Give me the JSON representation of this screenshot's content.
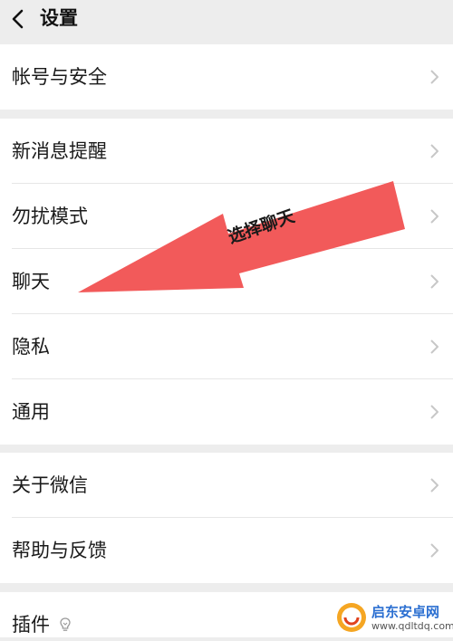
{
  "header": {
    "title": "设置"
  },
  "groups": [
    {
      "items": [
        {
          "label": "帐号与安全"
        }
      ]
    },
    {
      "items": [
        {
          "label": "新消息提醒"
        },
        {
          "label": "勿扰模式"
        },
        {
          "label": "聊天"
        },
        {
          "label": "隐私"
        },
        {
          "label": "通用"
        }
      ]
    },
    {
      "items": [
        {
          "label": "关于微信"
        },
        {
          "label": "帮助与反馈"
        }
      ]
    },
    {
      "items": [
        {
          "label": "插件"
        }
      ]
    }
  ],
  "annotation": {
    "text": "选择聊天",
    "color": "#f25a5a"
  },
  "watermark": {
    "name": "启东安卓网",
    "url": "www.qdltdq.com"
  }
}
